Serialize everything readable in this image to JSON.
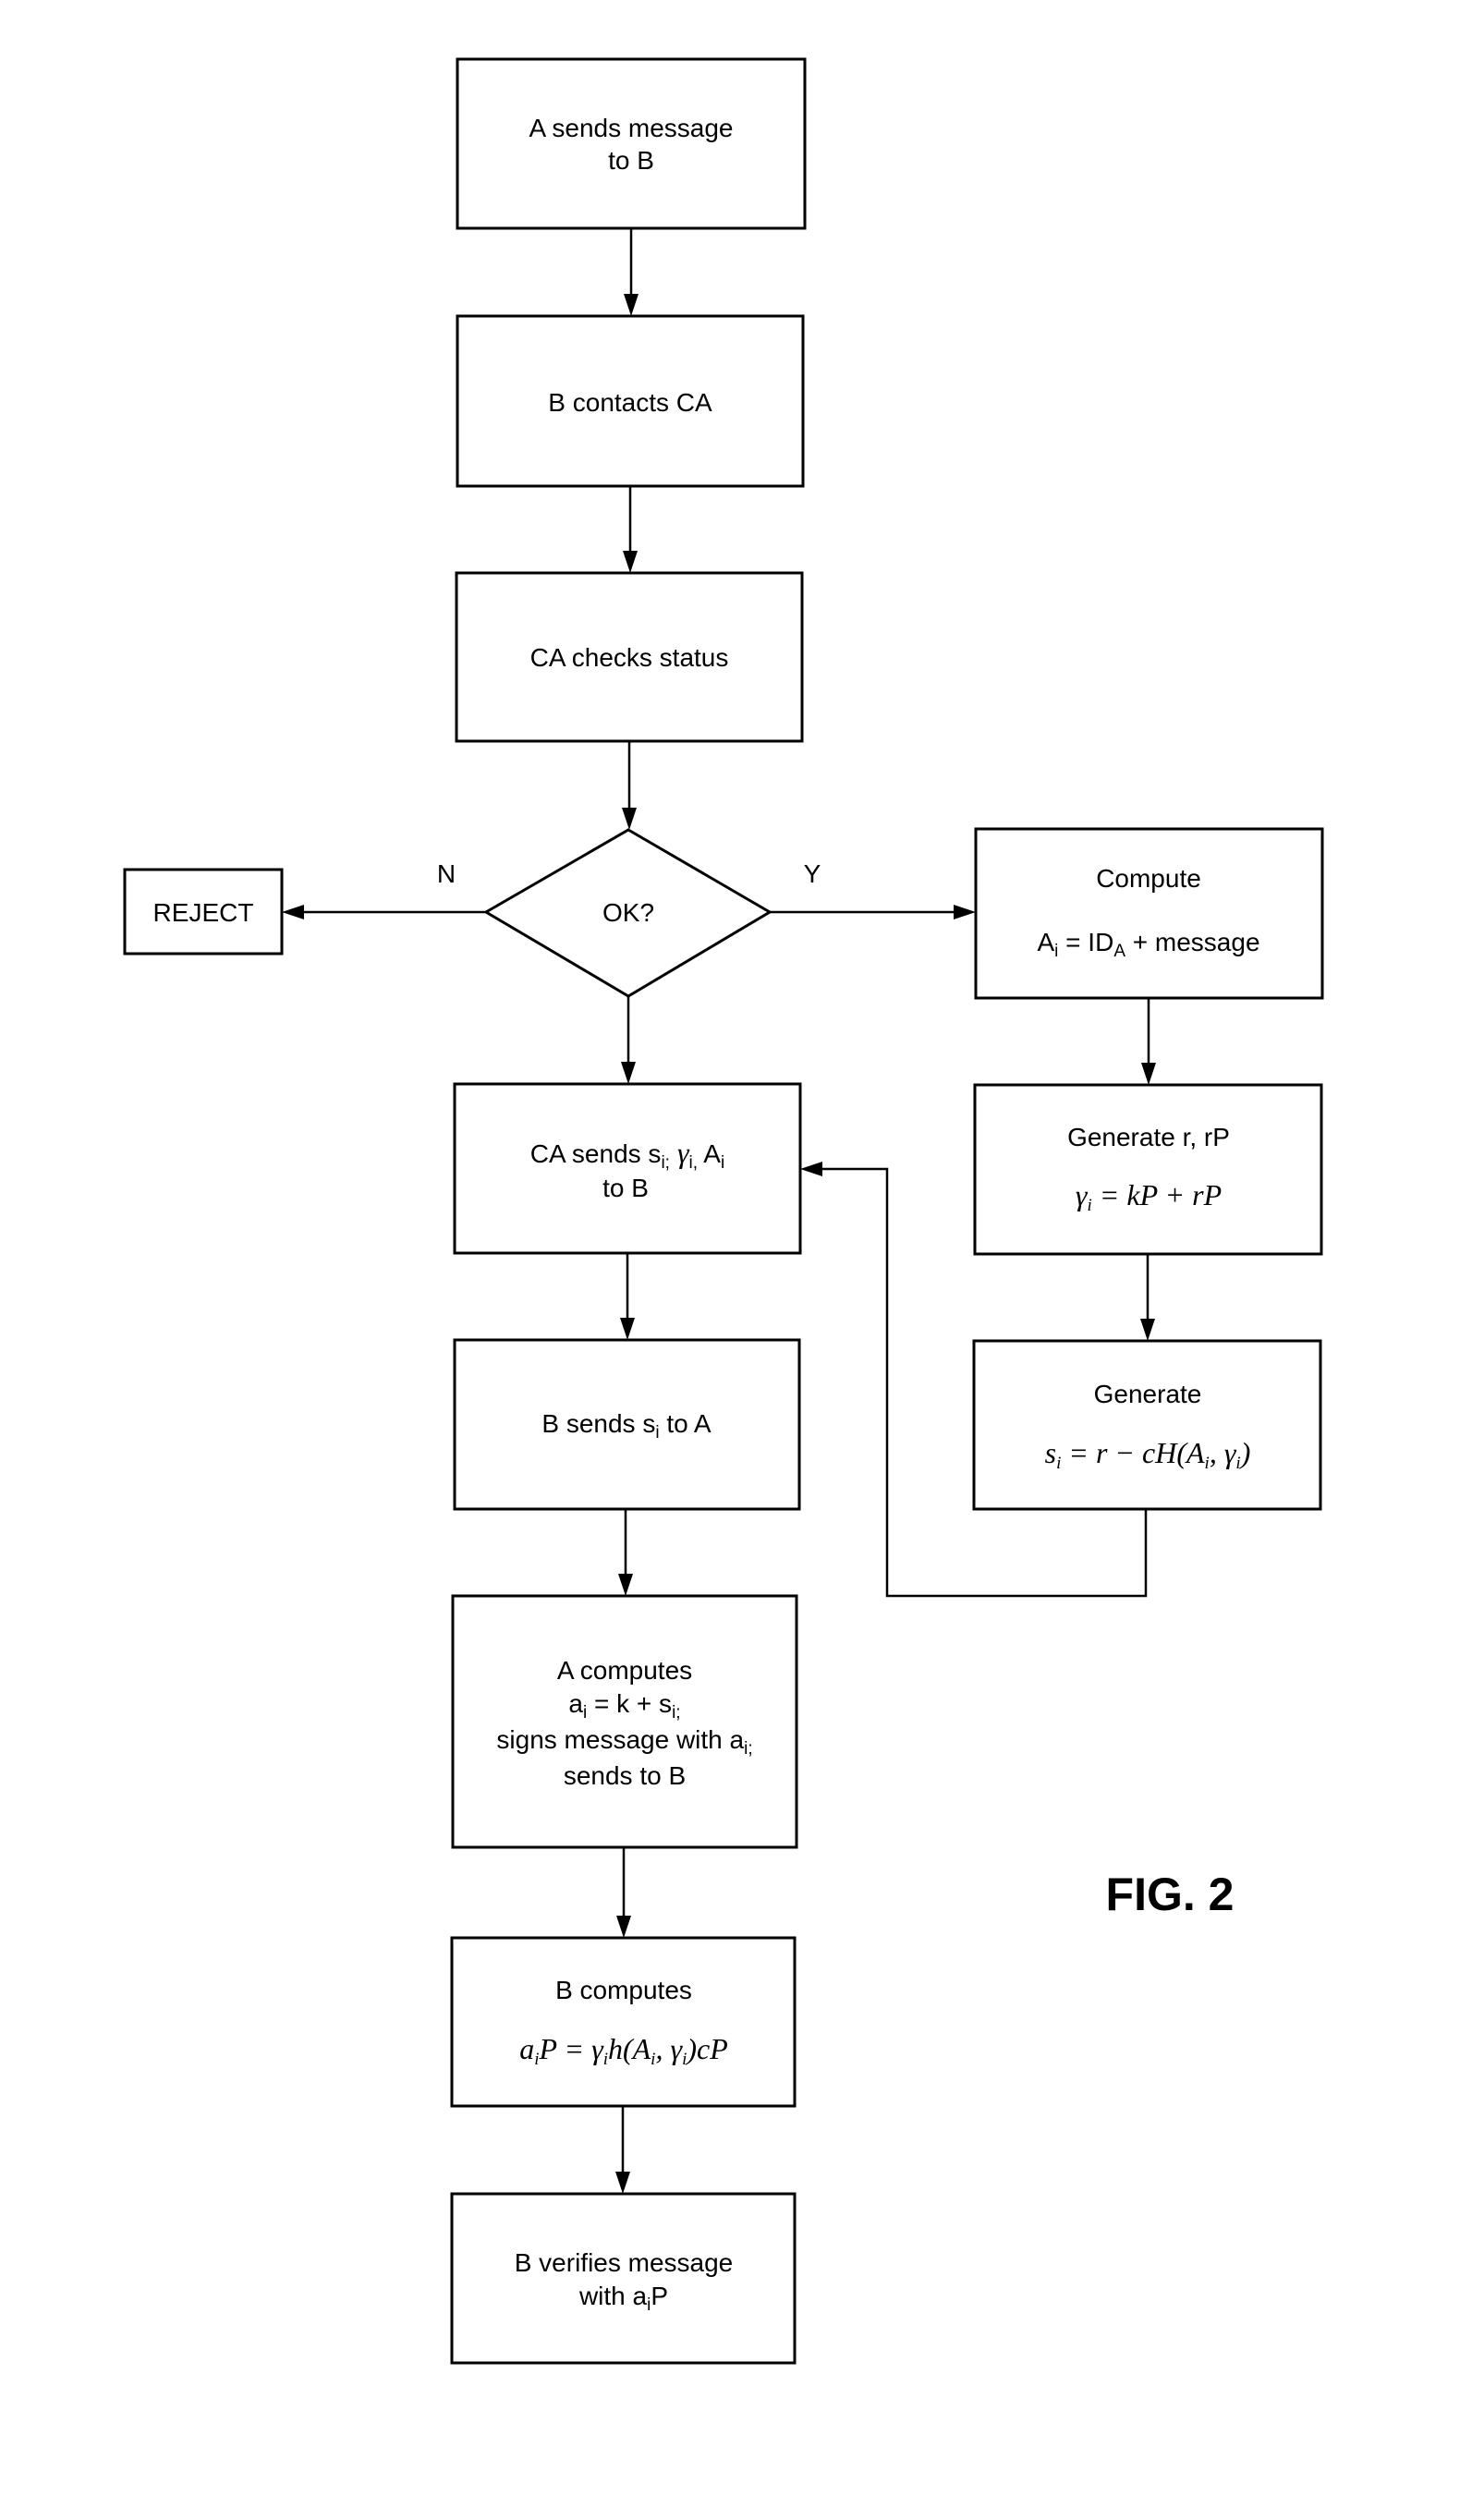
{
  "figure": {
    "label": "FIG. 2",
    "nodes": {
      "a_sends": {
        "lines": [
          "A sends message",
          "to B"
        ]
      },
      "b_contacts": {
        "lines": [
          "B contacts CA"
        ]
      },
      "ca_checks": {
        "lines": [
          "CA checks status"
        ]
      },
      "decision": {
        "label": "OK?",
        "no_label": "N",
        "yes_label": "Y"
      },
      "reject": {
        "label": "REJECT"
      },
      "compute": {
        "title": "Compute",
        "formula": {
          "A": "A",
          "i": "i",
          "eq": " = ID",
          "A2": "A",
          "rest": " + message"
        }
      },
      "gen_r": {
        "title": "Generate r, rP",
        "formula": {
          "gamma": "γ",
          "i": "i",
          "rest": " = kP + rP"
        }
      },
      "gen_s": {
        "title": "Generate",
        "formula": {
          "s": "s",
          "i": "i",
          "rest1": " = r − cH(A",
          "i2": "i",
          "rest2": ", γ",
          "i3": "i",
          "rest3": ")"
        }
      },
      "ca_sends": {
        "line1": {
          "a": "CA sends s",
          "i": "i;",
          "gamma": " γ",
          "gi": "i,",
          "b": " A",
          "bi": "i"
        },
        "line2": "to B"
      },
      "b_sends": {
        "a": "B sends s",
        "i": "i",
        "b": " to A"
      },
      "a_computes": {
        "line1": "A computes",
        "line2": {
          "a": "a",
          "i": "i",
          "b": " = k + s",
          "si": "i;"
        },
        "line3": {
          "a": "signs message with a",
          "i": "i;"
        },
        "line4": "sends to B"
      },
      "b_computes": {
        "title": "B computes",
        "formula": {
          "a": "a",
          "i": "i",
          "b": "P = γ",
          "gi": "i",
          "c": "h(A",
          "ai": "i",
          "d": ", γ",
          "gi2": "i",
          "e": ")cP"
        }
      },
      "b_verifies": {
        "line1": "B verifies message",
        "line2": {
          "a": "with a",
          "i": "i",
          "b": "P"
        }
      }
    }
  }
}
